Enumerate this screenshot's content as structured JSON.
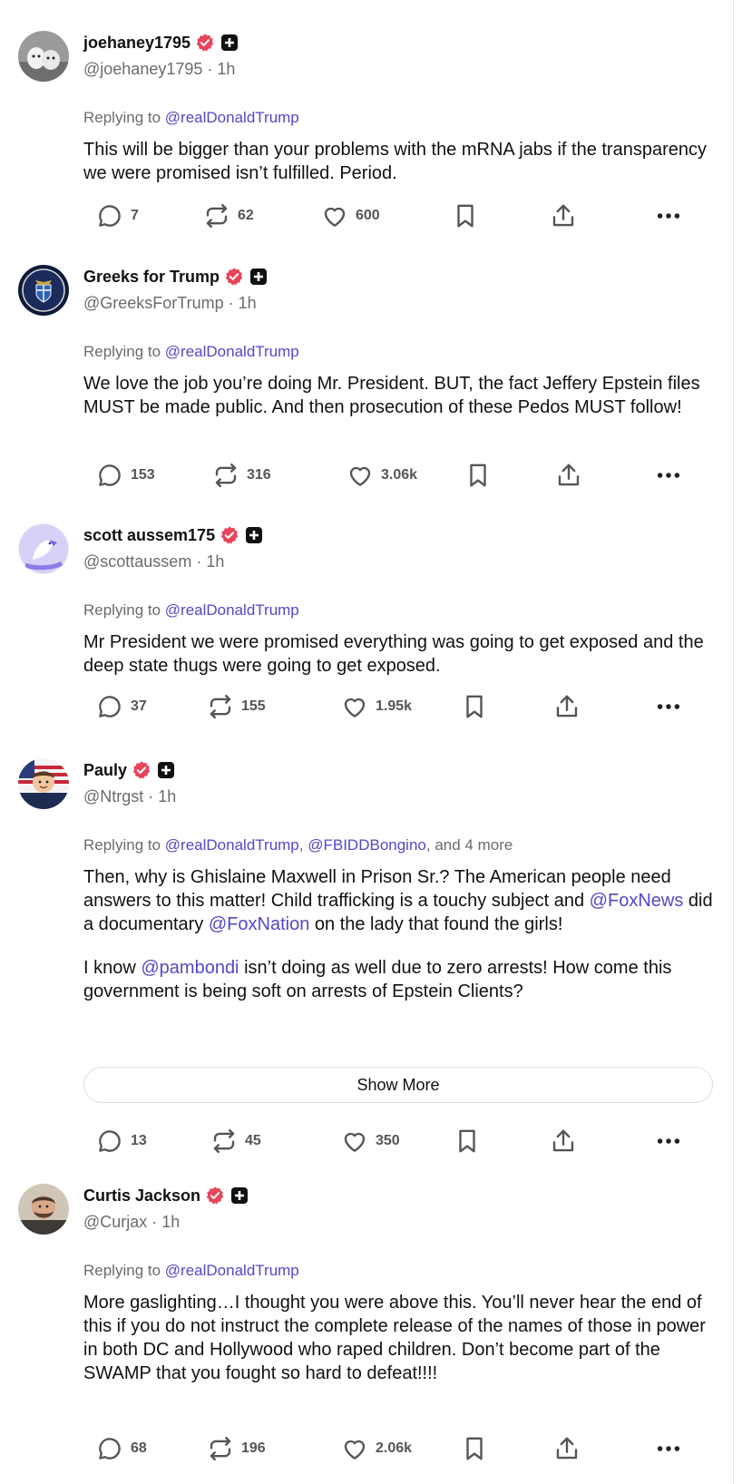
{
  "posts": [
    {
      "display_name": "joehaney1795",
      "handle": "@joehaney1795",
      "time": "1h",
      "replying_label": "Replying to",
      "replying_to": [
        "@realDonaldTrump"
      ],
      "replying_more": "",
      "paragraphs": [
        [
          {
            "t": "This will be bigger than your problems with the mRNA jabs if the transparency we were promised isn’t fulfilled.  Period."
          }
        ]
      ],
      "replies": "7",
      "reposts": "62",
      "likes": "600"
    },
    {
      "display_name": "Greeks for Trump",
      "handle": "@GreeksForTrump",
      "time": "1h",
      "replying_label": "Replying to",
      "replying_to": [
        "@realDonaldTrump"
      ],
      "replying_more": "",
      "paragraphs": [
        [
          {
            "t": "We love the job you’re doing Mr. President. BUT, the fact Jeffery Epstein files MUST be made public. And then prosecution of these Pedos MUST follow!"
          }
        ]
      ],
      "replies": "153",
      "reposts": "316",
      "likes": "3.06k"
    },
    {
      "display_name": "scott aussem175",
      "handle": "@scottaussem",
      "time": "1h",
      "replying_label": "Replying to",
      "replying_to": [
        "@realDonaldTrump"
      ],
      "replying_more": "",
      "paragraphs": [
        [
          {
            "t": "Mr President we were promised everything was going to get exposed and the deep state thugs were going to get exposed."
          }
        ]
      ],
      "replies": "37",
      "reposts": "155",
      "likes": "1.95k"
    },
    {
      "display_name": "Pauly",
      "handle": "@Ntrgst",
      "time": "1h",
      "replying_label": "Replying to",
      "replying_to": [
        "@realDonaldTrump",
        "@FBIDDBongino"
      ],
      "replying_more": ", and 4 more",
      "paragraphs": [
        [
          {
            "t": "Then, why is Ghislaine Maxwell in Prison Sr.? The American people need answers to this matter! Child trafficking is a touchy subject and "
          },
          {
            "t": "@FoxNews",
            "m": true
          },
          {
            "t": " did a documentary "
          },
          {
            "t": "@FoxNation",
            "m": true
          },
          {
            "t": " on the lady that found the girls!"
          }
        ],
        [
          {
            "t": "I know "
          },
          {
            "t": "@pambondi",
            "m": true
          },
          {
            "t": " isn’t doing as well due to zero arrests! How come this government is being soft on arrests of Epstein Clients?"
          }
        ]
      ],
      "show_more": "Show More",
      "replies": "13",
      "reposts": "45",
      "likes": "350"
    },
    {
      "display_name": "Curtis Jackson",
      "handle": "@Curjax",
      "time": "1h",
      "replying_label": "Replying to",
      "replying_to": [
        "@realDonaldTrump"
      ],
      "replying_more": "",
      "paragraphs": [
        [
          {
            "t": "More gaslighting…I thought you were above this. You’ll never hear the end of this if you do not instruct the complete release of the names of those in power in both DC and Hollywood who raped children. Don’t become part of the SWAMP that you fought so hard to defeat!!!!"
          }
        ]
      ],
      "replies": "68",
      "reposts": "196",
      "likes": "2.06k"
    }
  ],
  "icons": {
    "verified": "verified-badge-icon",
    "plus": "plus-badge-icon",
    "reply": "reply-icon",
    "repost": "repost-icon",
    "like": "heart-icon",
    "bookmark": "bookmark-icon",
    "share": "share-icon",
    "more": "more-icon"
  },
  "colors": {
    "mention": "#5448c8",
    "verified": "#e8445a",
    "muted_text": "#6b6b6b"
  }
}
